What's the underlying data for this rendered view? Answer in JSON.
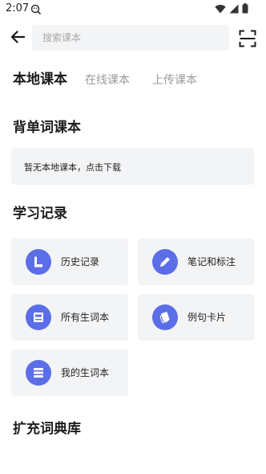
{
  "status_bar": {
    "time": "2:07",
    "icons": [
      "app-notification-icon",
      "wifi-icon",
      "signal-icon",
      "battery-icon"
    ]
  },
  "top_bar": {
    "back_icon": "arrow-left-icon",
    "search_placeholder": "搜索课本",
    "search_value": "",
    "scan_icon": "scan-icon"
  },
  "tabs": [
    {
      "label": "本地课本",
      "active": true
    },
    {
      "label": "在线课本",
      "active": false
    },
    {
      "label": "上传课本",
      "active": false
    }
  ],
  "word_book_section": {
    "title": "背单词课本",
    "empty_text": "暂无本地课本，点击下载"
  },
  "study_records_section": {
    "title": "学习记录",
    "items": [
      {
        "label": "历史记录",
        "icon": "history-icon"
      },
      {
        "label": "笔记和标注",
        "icon": "pencil-icon"
      },
      {
        "label": "所有生词本",
        "icon": "book-icon"
      },
      {
        "label": "例句卡片",
        "icon": "cards-icon"
      },
      {
        "label": "我的生词本",
        "icon": "list-icon"
      }
    ]
  },
  "dictionary_section": {
    "title": "扩充词典库"
  },
  "colors": {
    "accent": "#5b6ee8",
    "card_bg": "#f3f4f6",
    "inactive_tab": "#9a9a9a"
  }
}
